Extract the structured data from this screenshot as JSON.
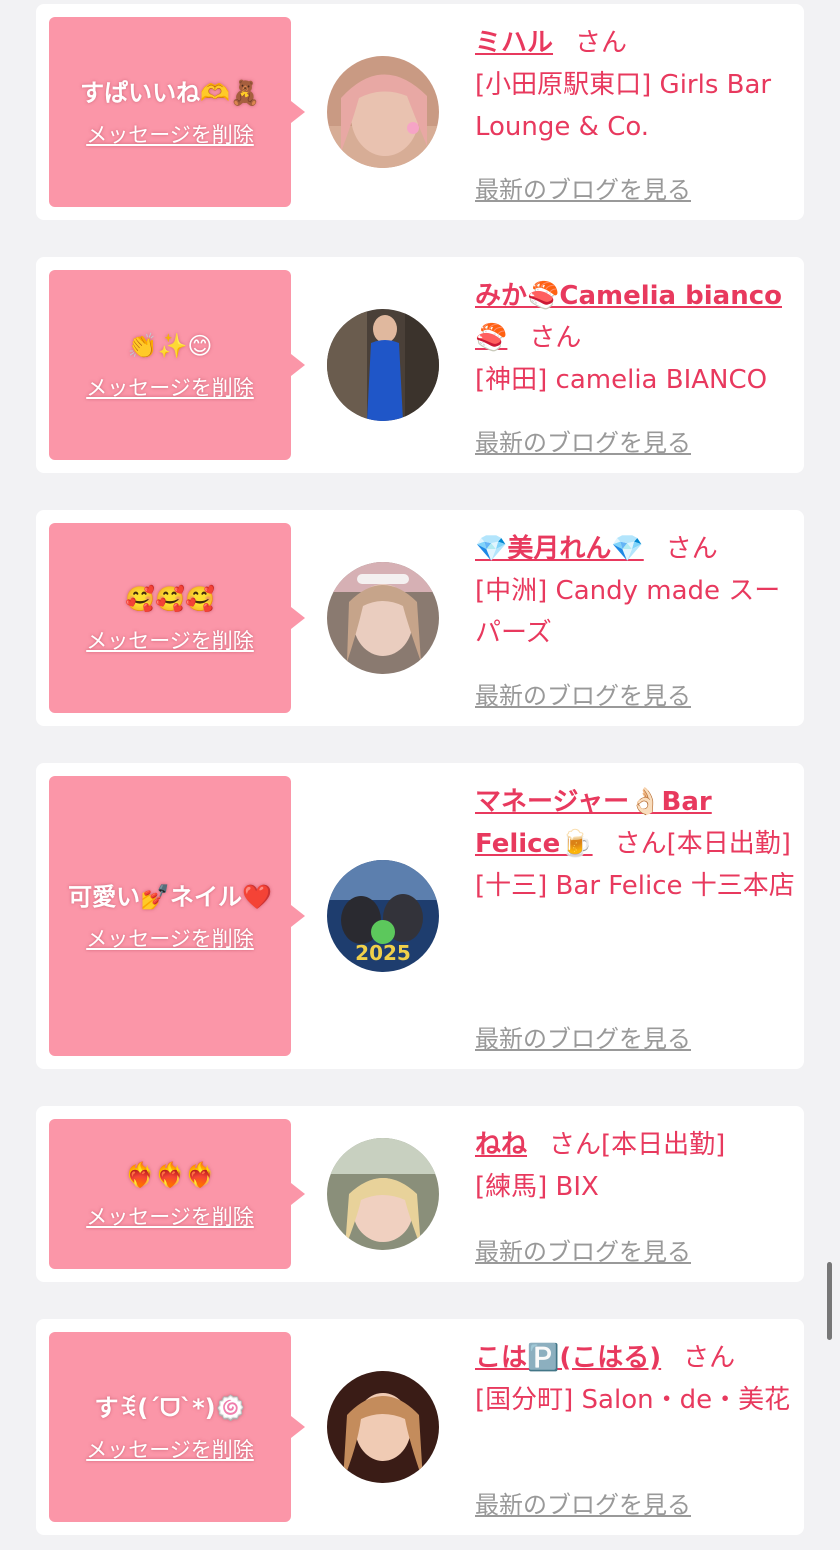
{
  "delete_label": "メッセージを削除",
  "blog_label": "最新のブログを見る",
  "san_label": "さん",
  "entries": [
    {
      "message": "すぱいいね🫶🧸",
      "name": "ミハル",
      "attendance": "",
      "store": "[小田原駅東口] Girls Bar Lounge & Co."
    },
    {
      "message": "👏✨😊",
      "name": "みか🍣Camelia bianco🍣",
      "attendance": "",
      "store": "[神田] camelia BIANCO"
    },
    {
      "message": "🥰🥰🥰",
      "name": "💎美月れん💎",
      "attendance": "",
      "store": "[中洲] Candy made スーパーズ"
    },
    {
      "message": "可愛い💅ネイル❤️",
      "name": "マネージャー👌🏻Bar Felice🍺",
      "attendance": "[本日出勤]",
      "store": "[十三] Bar Felice 十三本店"
    },
    {
      "message": "❤️‍🔥❤️‍🔥❤️‍🔥",
      "name": "ねね",
      "attendance": "[本日出勤]",
      "store": "[練馬] BIX"
    },
    {
      "message": "すꉂ(ˊᗜˋ*)🍥",
      "name": "こは🅿️(こはる)",
      "attendance": "",
      "store": "[国分町] Salon・de・美花"
    }
  ],
  "colors": {
    "accent": "#e8395e",
    "bubble": "#fb96a8",
    "link_gray": "#999999",
    "background": "#f2f2f4"
  }
}
